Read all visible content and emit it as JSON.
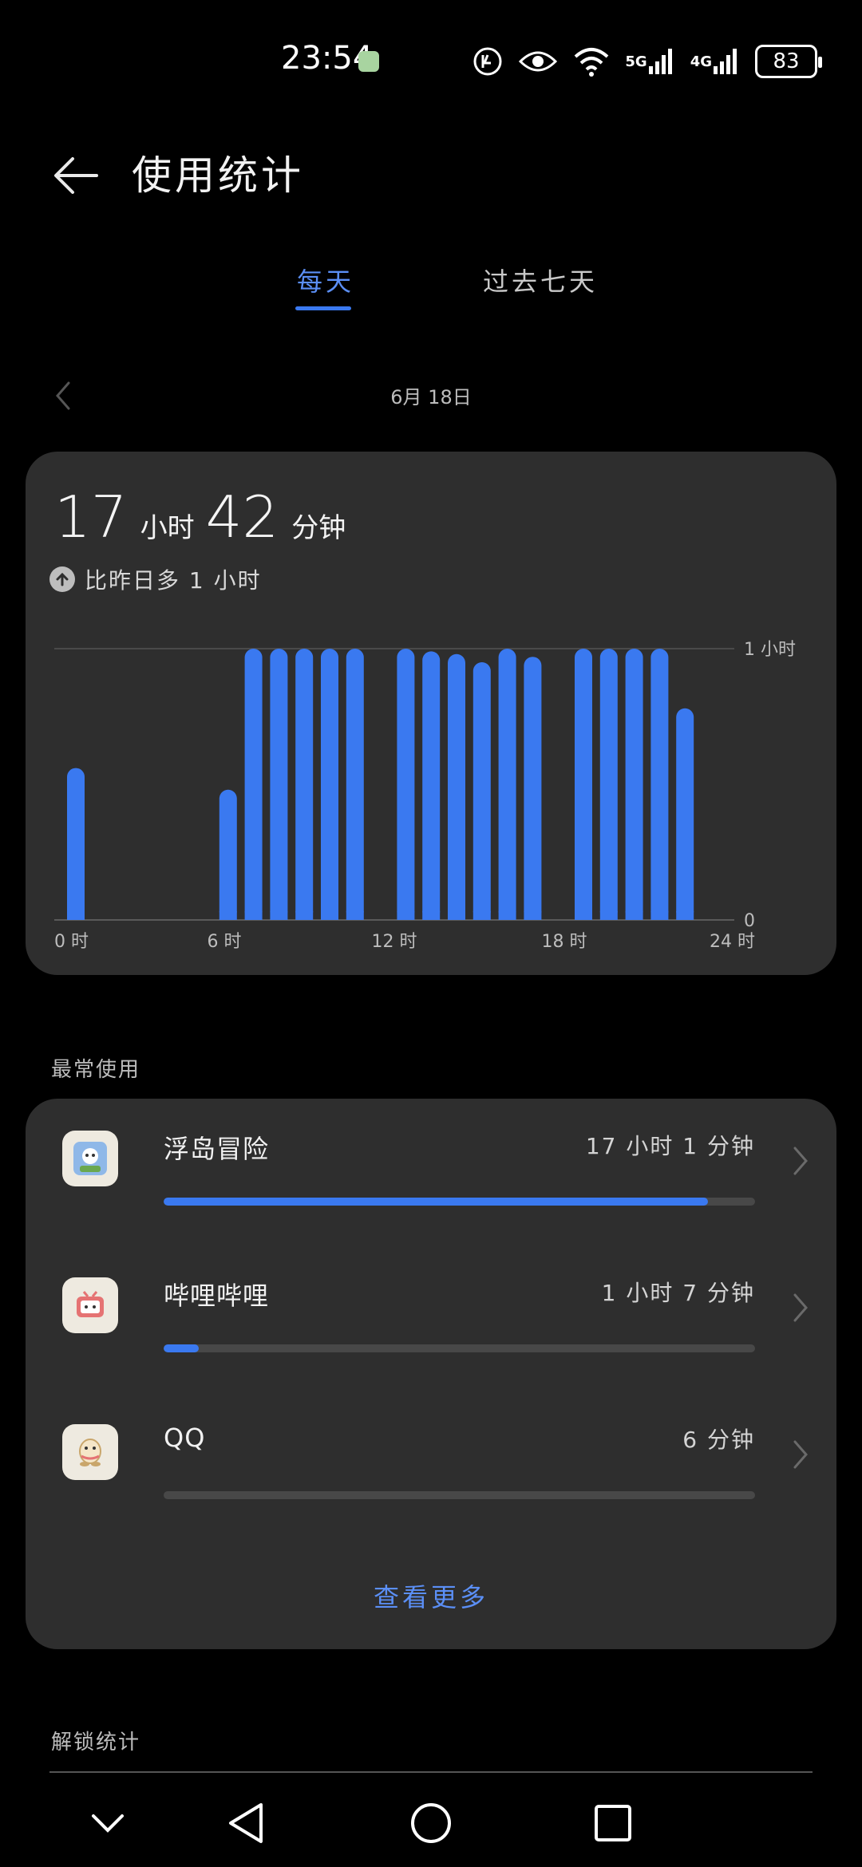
{
  "status_bar": {
    "time": "23:54",
    "network_5g": "5G",
    "network_4g": "4G",
    "battery": "83"
  },
  "header": {
    "title": "使用统计"
  },
  "tabs": [
    {
      "label": "每天",
      "active": true
    },
    {
      "label": "过去七天",
      "active": false
    }
  ],
  "date": {
    "label": "6月 18日"
  },
  "summary": {
    "hours": "17",
    "hours_unit": "小时",
    "minutes": "42",
    "minutes_unit": "分钟",
    "compare_text": "比昨日多 1 小时"
  },
  "chart_data": {
    "type": "bar",
    "x": [
      0,
      1,
      2,
      3,
      4,
      5,
      6,
      7,
      8,
      9,
      10,
      11,
      12,
      13,
      14,
      15,
      16,
      17,
      18,
      19,
      20,
      21,
      22,
      23
    ],
    "values": [
      0.56,
      0,
      0,
      0,
      0,
      0,
      0.48,
      1.0,
      1.0,
      1.0,
      1.0,
      1.0,
      0,
      1.0,
      0.99,
      0.98,
      0.95,
      1.0,
      0.97,
      0,
      1.0,
      1.0,
      1.0,
      1.0
    ],
    "extra_bar": {
      "x": 24,
      "value": 0.78
    },
    "xtick_labels": [
      "0 时",
      "6 时",
      "12 时",
      "18 时",
      "24 时"
    ],
    "ytick_labels": [
      "1 小时",
      "0"
    ],
    "ylim": [
      0,
      1
    ],
    "color": "#3a79f0"
  },
  "most_used": {
    "label": "最常使用",
    "apps": [
      {
        "name": "浮岛冒险",
        "time": "17 小时 1 分钟",
        "fraction": 0.92
      },
      {
        "name": "哔哩哔哩",
        "time": "1 小时 7 分钟",
        "fraction": 0.06
      },
      {
        "name": "QQ",
        "time": "6 分钟",
        "fraction": 0.0
      }
    ],
    "see_more": "查看更多"
  },
  "unlock": {
    "label": "解锁统计"
  },
  "colors": {
    "accent": "#3a79f0",
    "card": "#2e2e2e",
    "background": "#000000"
  }
}
